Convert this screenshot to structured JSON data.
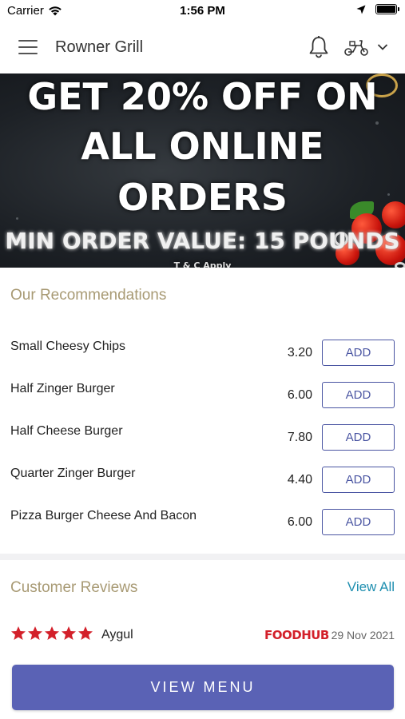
{
  "status_bar": {
    "carrier": "Carrier",
    "time": "1:56 PM"
  },
  "header": {
    "title": "Rowner Grill",
    "icons": [
      "menu-icon",
      "bell-icon",
      "scooter-icon",
      "chevron-down-icon"
    ]
  },
  "banner": {
    "line1": "GET 20% OFF ON",
    "line2": "ALL ONLINE",
    "line3": "ORDERS",
    "line4": "MIN ORDER VALUE: 15 POUNDS",
    "line5": "T & C Apply"
  },
  "recommendations": {
    "title": "Our Recommendations",
    "items": [
      {
        "name": "Small Cheesy Chips",
        "price": "3.20",
        "button": "ADD"
      },
      {
        "name": "Half Zinger Burger",
        "price": "6.00",
        "button": "ADD"
      },
      {
        "name": "Half Cheese Burger",
        "price": "7.80",
        "button": "ADD"
      },
      {
        "name": "Quarter Zinger Burger",
        "price": "4.40",
        "button": "ADD"
      },
      {
        "name": "Pizza Burger Cheese And Bacon",
        "price": "6.00",
        "button": "ADD"
      }
    ]
  },
  "reviews": {
    "title": "Customer Reviews",
    "view_all": "View All",
    "items": [
      {
        "rating": 5,
        "reviewer": "Aygul",
        "source": "FOODHUB",
        "date": "29 Nov 2021"
      }
    ]
  },
  "view_menu_button": "VIEW MENU",
  "colors": {
    "accent": "#5a62b5",
    "add_button": "#4a55a2",
    "section_title": "#a89a74",
    "link": "#1f8fb0",
    "star": "#d3202a",
    "foodhub": "#d3202a"
  }
}
